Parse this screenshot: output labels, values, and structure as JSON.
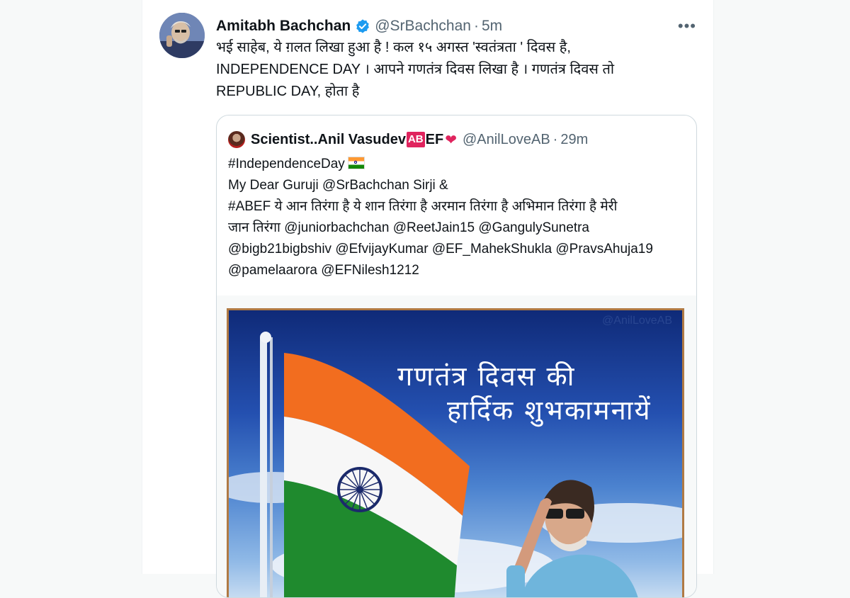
{
  "tweet": {
    "author_name": "Amitabh Bachchan",
    "handle": "@SrBachchan",
    "separator": "·",
    "time": "5m",
    "more_icon": "more-horizontal-icon",
    "verified_color": "#1d9bf0",
    "text_lines": [
      "भई साहेब, ये ग़लत लिखा हुआ  है  ! कल १५ अगस्त 'स्वतंत्रता ' दिवस है,",
      "INDEPENDENCE DAY  । आपने गणतंत्र दिवस लिखा है  । गणतंत्र दिवस तो",
      "REPUBLIC DAY, होता है"
    ]
  },
  "quote": {
    "author_name": "Scientist..Anil Vasudev",
    "badge": "AB",
    "name_suffix": "EF",
    "heart": "❤",
    "handle": "@AnilLoveAB",
    "separator": "·",
    "time": "29m",
    "text_lines": [
      "#IndependenceDay",
      "My Dear Guruji @SrBachchan Sirji &",
      "#ABEF ये आन तिरंगा है ये शान तिरंगा है अरमान तिरंगा है अभिमान तिरंगा है मेरी",
      "जान तिरंगा @juniorbachchan @ReetJain15 @GangulySunetra",
      "@bigb21bigbshiv @EfvijayKumar @EF_MahekShukla @PravsAhuja19",
      "@pamelaarora @EFNilesh1212"
    ],
    "media": {
      "watermark": "@AnilLoveAB",
      "line1": "गणतंत्र दिवस  की",
      "line2": "हार्दिक शुभकामनायें"
    }
  }
}
